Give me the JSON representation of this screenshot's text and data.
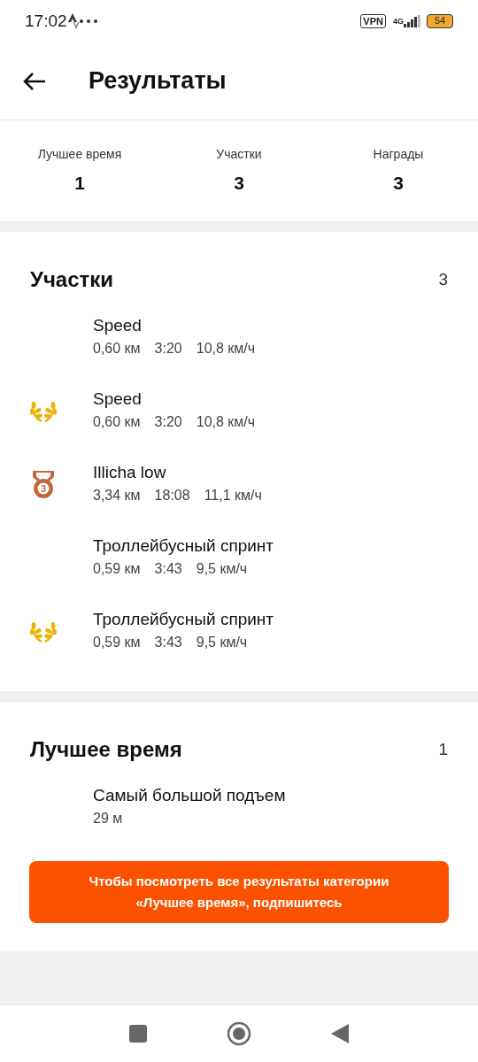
{
  "status_bar": {
    "time": "17:02",
    "vpn": "VPN",
    "network": "4G",
    "battery": "54"
  },
  "header": {
    "title": "Результаты"
  },
  "stats": [
    {
      "label": "Лучшее время",
      "value": "1"
    },
    {
      "label": "Участки",
      "value": "3"
    },
    {
      "label": "Награды",
      "value": "3"
    }
  ],
  "segments": {
    "title": "Участки",
    "count": "3",
    "items": [
      {
        "name": "Speed",
        "distance": "0,60 км",
        "time": "3:20",
        "speed": "10,8 км/ч",
        "kind": "plain"
      },
      {
        "name": "Speed",
        "distance": "0,60 км",
        "time": "3:20",
        "speed": "10,8 км/ч",
        "kind": "laurel"
      },
      {
        "name": "Illicha low",
        "distance": "3,34 км",
        "time": "18:08",
        "speed": "11,1 км/ч",
        "kind": "medal",
        "rank": "3"
      },
      {
        "name": "Троллейбусный спринт",
        "distance": "0,59 км",
        "time": "3:43",
        "speed": "9,5 км/ч",
        "kind": "plain"
      },
      {
        "name": "Троллейбусный спринт",
        "distance": "0,59 км",
        "time": "3:43",
        "speed": "9,5 км/ч",
        "kind": "laurel"
      }
    ]
  },
  "best_efforts": {
    "title": "Лучшее время",
    "count": "1",
    "items": [
      {
        "name": "Самый большой подъем",
        "value": "29 м"
      }
    ]
  },
  "subscribe_banner": {
    "text": "Чтобы посмотреть все результаты категории «Лучшее время», подпишитесь"
  }
}
